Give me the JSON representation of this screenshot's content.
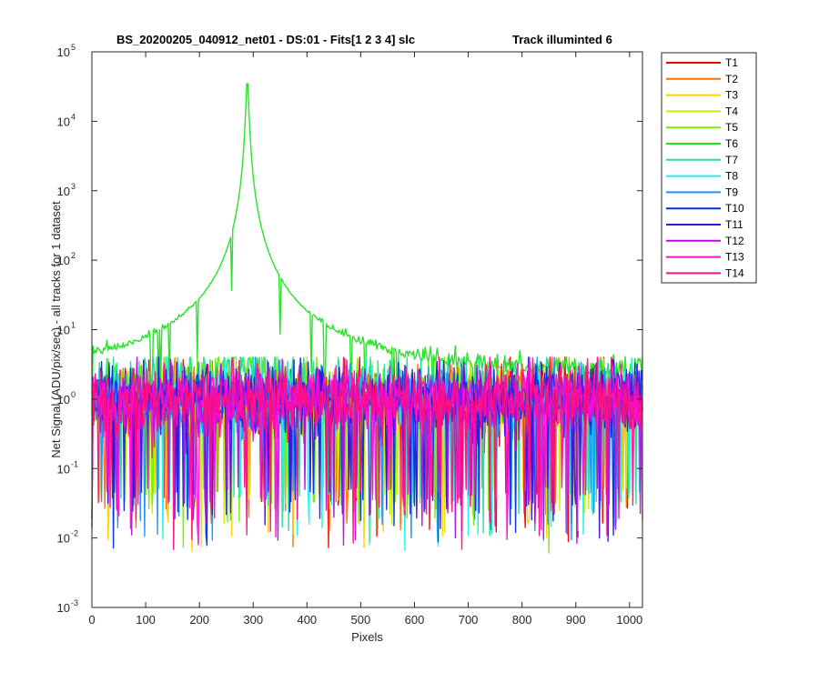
{
  "chart_data": {
    "type": "line",
    "title": "BS_20200205_040912_net01 - DS:01 - Fits[1  2  3  4]   slc",
    "title_right": "Track illuminted 6",
    "xlabel": "Pixels",
    "ylabel": "Net Signal (ADU/pix/sec) - all tracks for 1 dataset",
    "xlim": [
      0,
      1024
    ],
    "ylim": [
      0.001,
      100000
    ],
    "y_scale": "log",
    "grid": false,
    "legend_position": "outside-right",
    "x_ticks": [
      "0",
      "100",
      "200",
      "300",
      "400",
      "500",
      "600",
      "700",
      "800",
      "900",
      "1000"
    ],
    "y_ticks": [
      {
        "base": "10",
        "exp": "-3"
      },
      {
        "base": "10",
        "exp": "-2"
      },
      {
        "base": "10",
        "exp": "-1"
      },
      {
        "base": "10",
        "exp": "0"
      },
      {
        "base": "10",
        "exp": "1"
      },
      {
        "base": "10",
        "exp": "2"
      },
      {
        "base": "10",
        "exp": "3"
      },
      {
        "base": "10",
        "exp": "4"
      },
      {
        "base": "10",
        "exp": "5"
      }
    ],
    "illuminated_track": "T6",
    "peak": {
      "x": 289,
      "y": 42000
    },
    "noise_floor": {
      "median": 1.0,
      "min": 0.006,
      "max": 4.0
    },
    "series": [
      {
        "name": "T1",
        "color": "#f00000"
      },
      {
        "name": "T2",
        "color": "#ff7000"
      },
      {
        "name": "T3",
        "color": "#ffd000"
      },
      {
        "name": "T4",
        "color": "#c8f000"
      },
      {
        "name": "T5",
        "color": "#70f000"
      },
      {
        "name": "T6",
        "color": "#20e020"
      },
      {
        "name": "T7",
        "color": "#20e0a0"
      },
      {
        "name": "T8",
        "color": "#20f0f0"
      },
      {
        "name": "T9",
        "color": "#2090ff"
      },
      {
        "name": "T10",
        "color": "#0030e0"
      },
      {
        "name": "T11",
        "color": "#4010e0"
      },
      {
        "name": "T12",
        "color": "#b010e0"
      },
      {
        "name": "T13",
        "color": "#ff10d0"
      },
      {
        "name": "T14",
        "color": "#ff1080"
      }
    ]
  }
}
